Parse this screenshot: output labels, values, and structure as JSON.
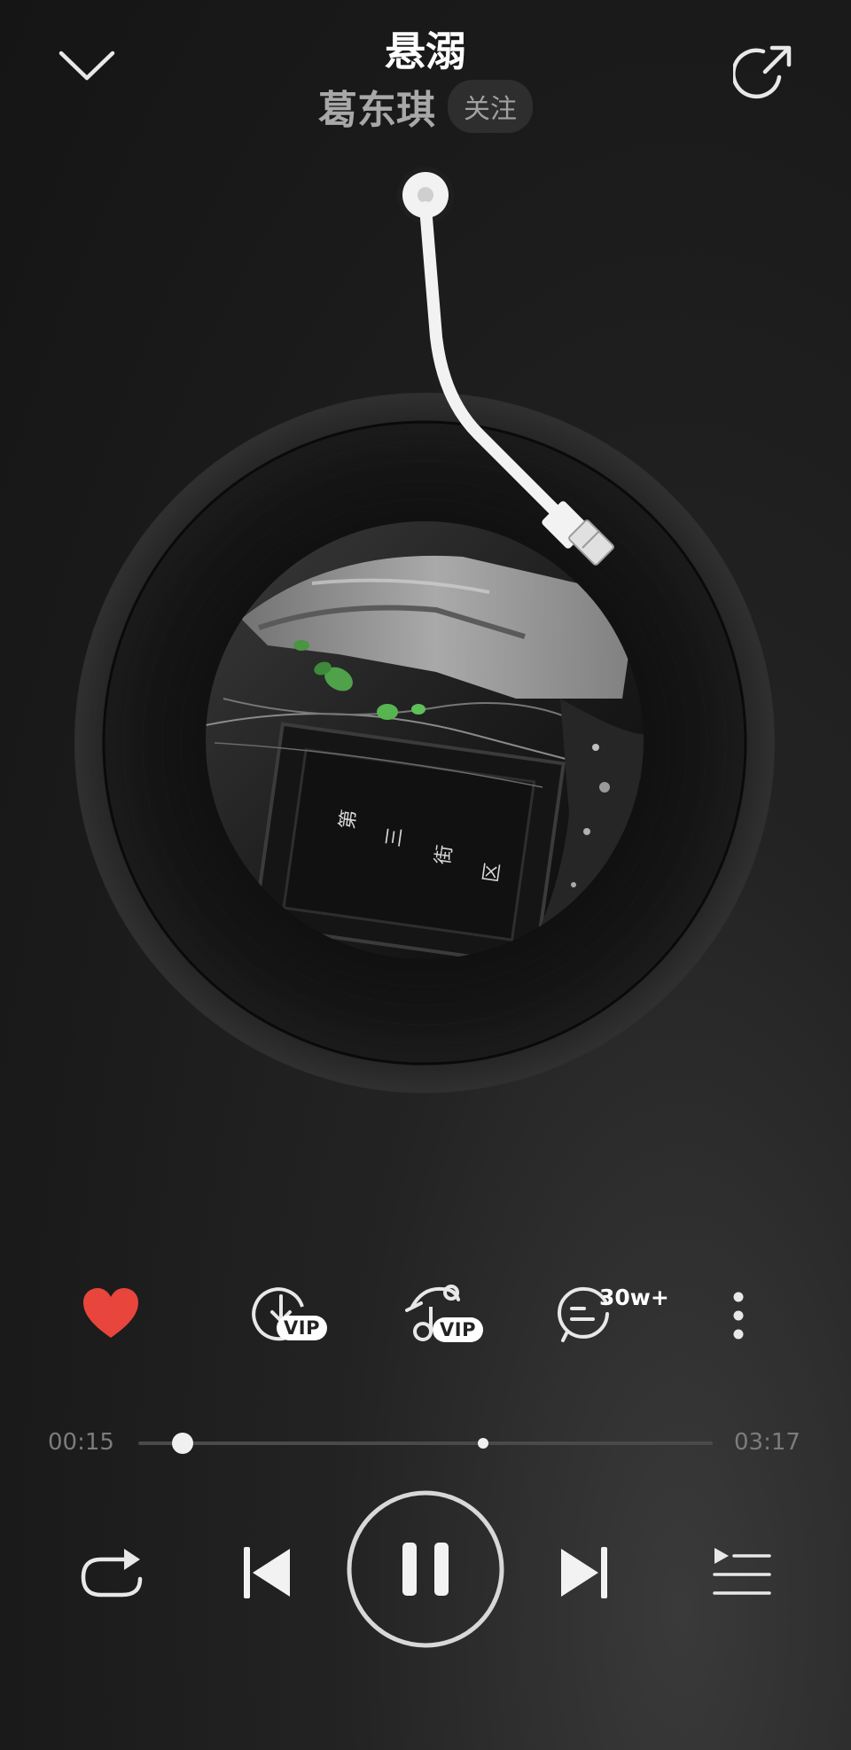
{
  "header": {
    "song_title": "悬溺",
    "artist": "葛东琪",
    "follow_label": "关注"
  },
  "album_cover": {
    "text_chars": [
      "第",
      "三",
      "街",
      "区"
    ]
  },
  "actions": {
    "download_vip": "VIP",
    "sound_effect_vip": "VIP",
    "comment_count": "30w+"
  },
  "progress": {
    "current_time": "00:15",
    "total_time": "03:17",
    "played_fraction": 0.077,
    "buffered_fraction": 0.6
  },
  "icons": {
    "collapse": "chevron-down-icon",
    "share": "share-icon",
    "like": "heart-icon",
    "download": "download-icon",
    "sound": "music-note-icon",
    "comment": "comment-icon",
    "more": "more-vertical-icon",
    "repeat": "repeat-icon",
    "previous": "previous-icon",
    "pause": "pause-icon",
    "next": "next-icon",
    "playlist": "playlist-icon"
  },
  "colors": {
    "like_red": "#e8453c",
    "background": "#1b1b1b"
  }
}
